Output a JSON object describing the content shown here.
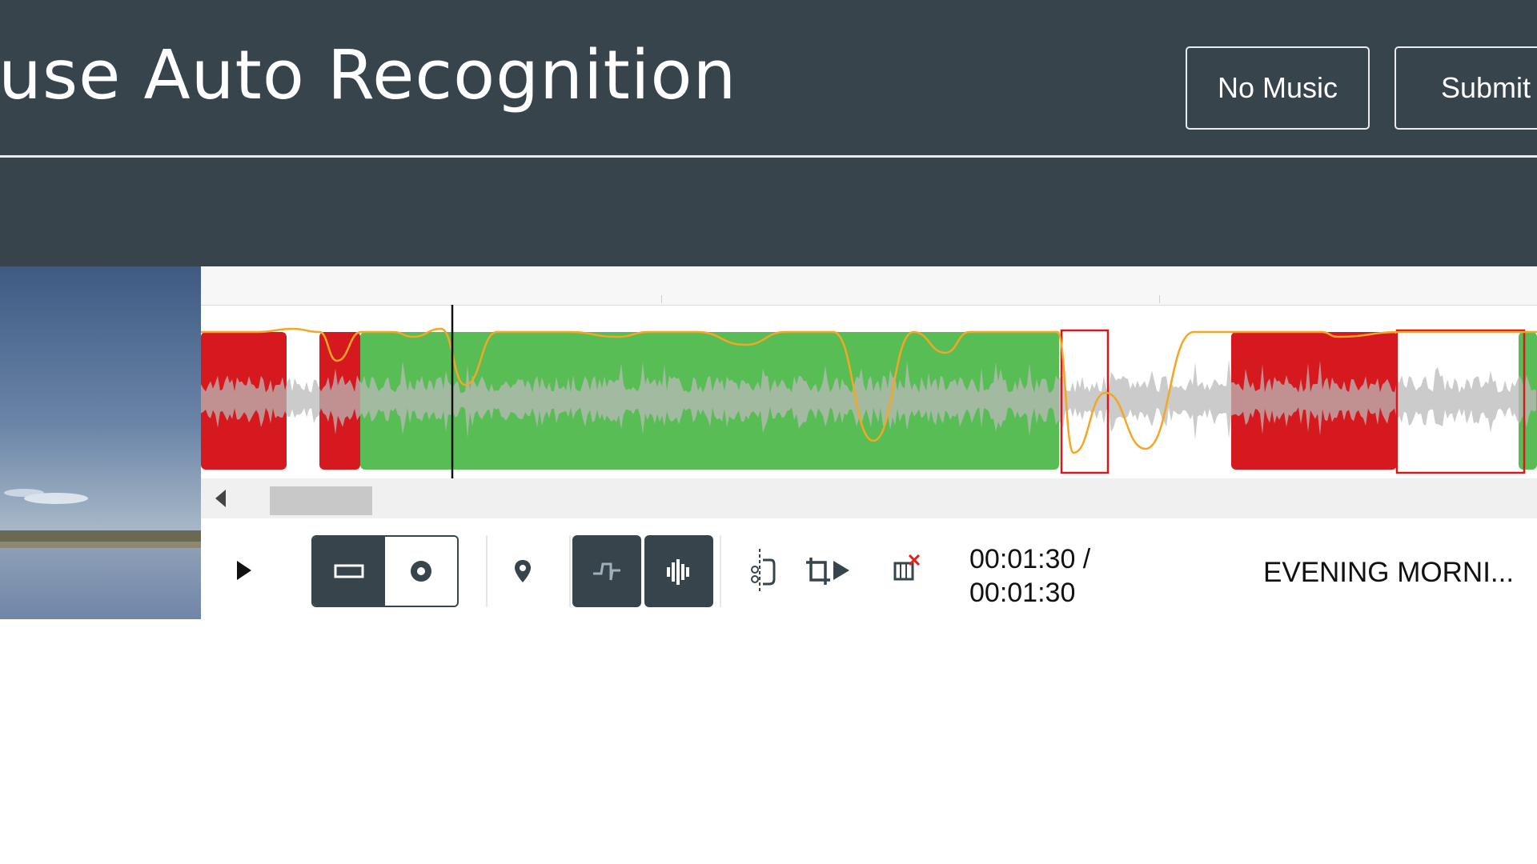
{
  "header": {
    "title": "use Auto Recognition",
    "buttons": {
      "no_music": "No Music",
      "submit": "Submit"
    }
  },
  "player": {
    "time_current": "00:01:30 /",
    "time_total": "00:01:30",
    "track_name": "EVENING MORNI..."
  },
  "toolbar_icons": [
    "play-icon",
    "rectangle-mode-icon",
    "circle-mode-icon",
    "location-pin-icon",
    "beat-icon",
    "waveform-icon",
    "split-icon",
    "crop-play-icon",
    "delete-segment-icon"
  ],
  "colors": {
    "header_bg": "#37444b",
    "music_segment": "#58bd55",
    "flagged_segment": "#d6191e",
    "curve": "#f5a623",
    "waveform": "#bdbdbd"
  }
}
